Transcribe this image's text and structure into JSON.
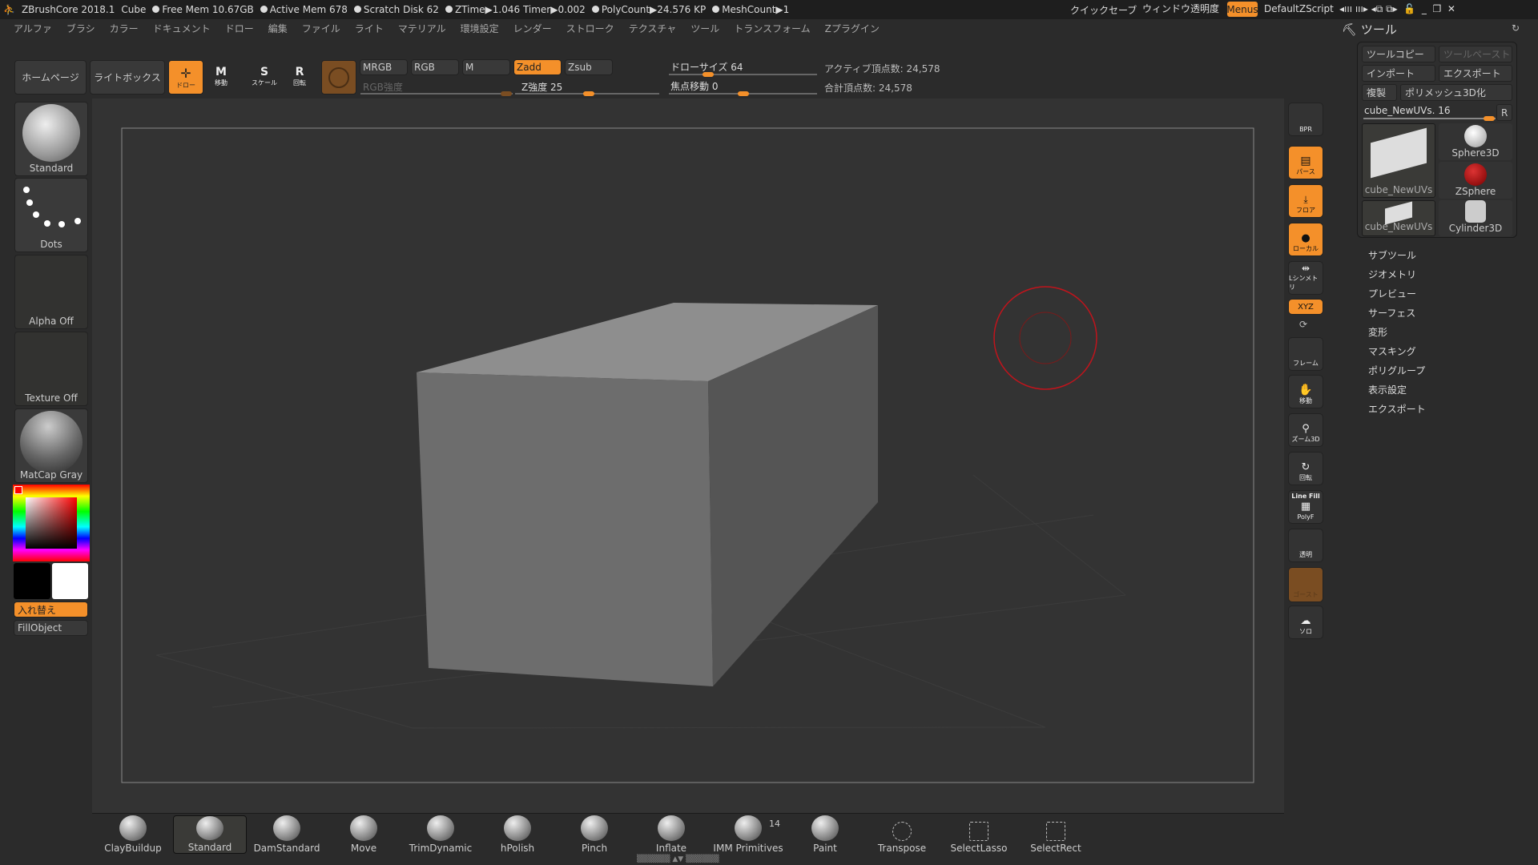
{
  "topbar": {
    "app": "ZBrushCore 2018.1",
    "doc": "Cube",
    "free_mem": "Free Mem 10.67GB",
    "active_mem": "Active Mem 678",
    "scratch": "Scratch Disk 62",
    "ztime": "ZTime▶1.046 Timer▶0.002",
    "polycount": "PolyCount▶24.576 KP",
    "meshcount": "MeshCount▶1",
    "quicksave": "クイックセーブ",
    "transparency": "ウィンドウ透明度",
    "menus": "Menus",
    "script": "DefaultZScript"
  },
  "menus": [
    "アルファ",
    "ブラシ",
    "カラー",
    "ドキュメント",
    "ドロー",
    "編集",
    "ファイル",
    "ライト",
    "マテリアル",
    "環境設定",
    "レンダー",
    "ストローク",
    "テクスチャ",
    "ツール",
    "トランスフォーム",
    "Zプラグイン"
  ],
  "toolbar": {
    "home": "ホームページ",
    "lightbox": "ライトボックス",
    "draw": "ドロー",
    "move": "移動",
    "scale": "スケール",
    "rotate": "回転",
    "mrgb": "MRGB",
    "rgb": "RGB",
    "m": "M",
    "zadd": "Zadd",
    "zsub": "Zsub",
    "rgb_intensity": "RGB強度",
    "z_intensity": "Z強度 25",
    "draw_size": "ドローサイズ 64",
    "focal_shift": "焦点移動 0",
    "active_points": "アクティブ頂点数: 24,578",
    "total_points": "合計頂点数: 24,578"
  },
  "values": {
    "z_intensity": 25,
    "draw_size": 64,
    "focal_shift": 0,
    "subtool_slider": 16
  },
  "left": {
    "brush": "Standard",
    "stroke": "Dots",
    "alpha": "Alpha Off",
    "texture": "Texture Off",
    "material": "MatCap Gray",
    "swap": "入れ替え",
    "fill": "FillObject"
  },
  "shelf": {
    "bpr": "BPR",
    "persp": "パース",
    "floor": "フロア",
    "local": "ローカル",
    "sym": "Lシンメトリ",
    "xyz": "XYZ",
    "frame": "フレーム",
    "move": "移動",
    "zoom": "ズーム3D",
    "rotate": "回転",
    "linefill": "Line Fill",
    "polyf": "PolyF",
    "transp": "透明",
    "ghost": "ゴースト",
    "solo": "ソロ"
  },
  "tool": {
    "title": "ツール",
    "copy": "ツールコピー",
    "paste": "ツールペースト",
    "import": "インポート",
    "export": "エクスポート",
    "clone": "複製",
    "polymesh": "ポリメッシュ3D化",
    "current": "cube_NewUVs. 16",
    "r": "R",
    "thumbs": [
      "cube_NewUVs",
      "Sphere3D",
      "ZSphere",
      "cube_NewUVs",
      "Cylinder3D"
    ],
    "sections": [
      "サブツール",
      "ジオメトリ",
      "プレビュー",
      "サーフェス",
      "変形",
      "マスキング",
      "ポリグループ",
      "表示設定",
      "エクスポート"
    ]
  },
  "brushes": [
    "ClayBuildup",
    "Standard",
    "DamStandard",
    "Move",
    "TrimDynamic",
    "hPolish",
    "Pinch",
    "Inflate",
    "IMM Primitives",
    "Paint",
    "Transpose",
    "SelectLasso",
    "SelectRect"
  ],
  "imm_count": "14",
  "colors": {
    "accent": "#f4902a",
    "brush_circle": "#c0141c"
  }
}
